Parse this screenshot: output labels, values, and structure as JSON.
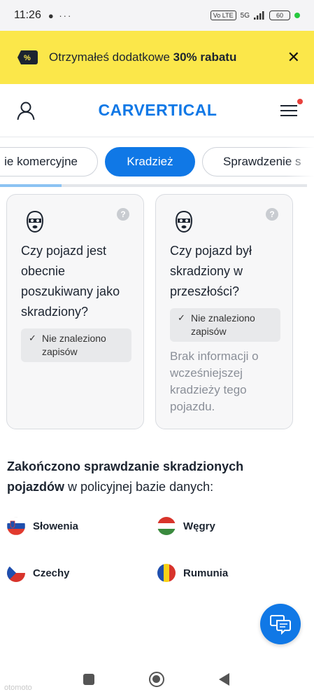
{
  "status_bar": {
    "time": "11:26",
    "left_icons": "● ···",
    "network": "5G",
    "lte": "Vo LTE",
    "battery": "60"
  },
  "promo": {
    "text_prefix": "Otrzymałeś dodatkowe ",
    "text_bold": "30% rabatu",
    "icon": "discount-tag-icon",
    "close_label": "✕",
    "background_color": "#fbe74a"
  },
  "header": {
    "logo": "CARVERTICAL",
    "brand_color": "#1078e6",
    "user_icon": "user-icon",
    "menu_icon": "hamburger-menu-icon"
  },
  "tabs": [
    {
      "label": "ie komercyjne",
      "active": false
    },
    {
      "label": "Kradzież",
      "active": true
    },
    {
      "label": "Sprawdzenie s",
      "active": false
    }
  ],
  "progress": {
    "fraction": 0.2
  },
  "cards": [
    {
      "question": "Czy pojazd jest obecnie poszukiwany jako skradziony?",
      "status": "Nie znaleziono zapisów",
      "note": ""
    },
    {
      "question": "Czy pojazd był skradziony w przeszłości?",
      "status": "Nie znaleziono zapisów",
      "note": "Brak informacji o wcześniejszej kradzieży tego pojazdu."
    }
  ],
  "help_label": "?",
  "check_mark": "✓",
  "checked_section": {
    "title_bold": "Zakończono sprawdzanie skradzionych pojazdów",
    "title_rest": " w policyjnej bazie danych:"
  },
  "countries": [
    {
      "name": "Słowenia",
      "flag": "slovenia-flag-icon"
    },
    {
      "name": "Węgry",
      "flag": "hungary-flag-icon"
    },
    {
      "name": "Czechy",
      "flag": "czech-flag-icon"
    },
    {
      "name": "Rumunia",
      "flag": "romania-flag-icon"
    }
  ],
  "chat": {
    "icon": "chat-icon"
  },
  "nav": {
    "recents": "recents-icon",
    "home": "home-icon",
    "back": "back-icon"
  },
  "watermark": "otomoto"
}
